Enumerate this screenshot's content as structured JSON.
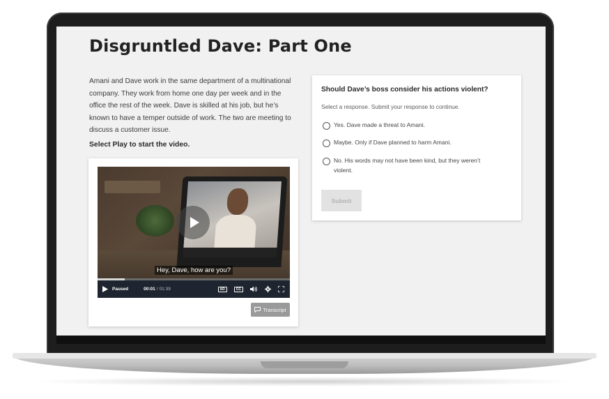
{
  "page": {
    "title": "Disgruntled Dave: Part One",
    "intro": "Amani and Dave work in the same department of a multinational company. They work from home one day per week and in the office the rest of the week. Dave is skilled at his job, but he’s known to have a temper outside of work. The two are meeting to discuss a customer issue.",
    "play_instruction": "Select Play to start the video."
  },
  "video": {
    "caption": "Hey, Dave, how are you?",
    "status": "Paused",
    "current_time": "00:01",
    "separator": "/",
    "duration": "01:39",
    "progress": 0.14,
    "ad_label": "AD",
    "cc_label": "CC",
    "icons": {
      "play_overlay": "play-icon",
      "play": "play-icon",
      "audio_description": "audio-description-icon",
      "captions": "closed-captions-icon",
      "volume": "volume-icon",
      "settings": "gear-icon",
      "fullscreen": "fullscreen-icon",
      "transcript": "transcript-icon"
    },
    "transcript_label": "Transcript"
  },
  "question": {
    "title": "Should Dave’s boss consider his actions violent?",
    "instruction": "Select a response. Submit your response to continue.",
    "options": [
      {
        "label": "Yes. Dave made a threat to Amani."
      },
      {
        "label": "Maybe. Only if Dave planned to harm Amani."
      },
      {
        "label": "No. His words may not have been kind, but they weren’t violent."
      }
    ],
    "submit_label": "Submit"
  },
  "colors": {
    "screen_bg": "#f1f1f1",
    "card_bg": "#ffffff",
    "control_bar": "#1f2530",
    "transcript_button": "#9a9a9a",
    "submit_disabled_bg": "#e2e2e2",
    "submit_disabled_text": "#b3b3b3",
    "laptop_frame": "#1d1d1d"
  }
}
